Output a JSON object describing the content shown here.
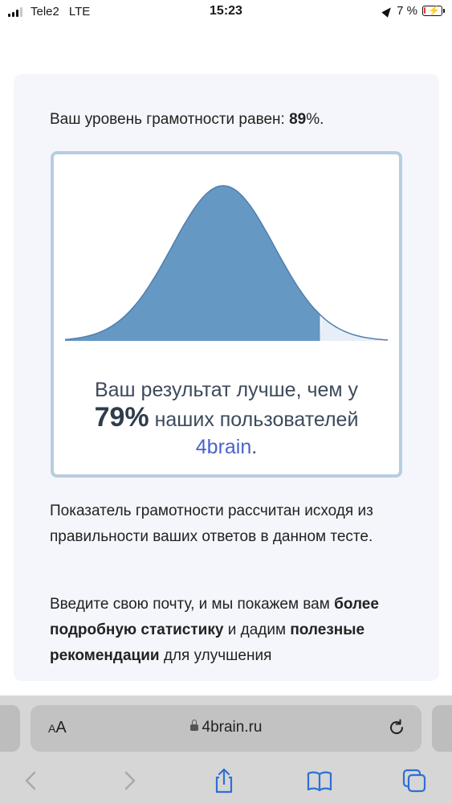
{
  "status_bar": {
    "carrier": "Tele2",
    "network": "LTE",
    "time": "15:23",
    "battery_percent": "7 %",
    "battery_level": 0.07
  },
  "card": {
    "level_prefix": "Ваш уровень грамотности равен: ",
    "level_value": "89",
    "level_suffix": "%.",
    "result": {
      "line1": "Ваш результат лучше, чем у",
      "percent": "79%",
      "line2_rest": " наших пользователей",
      "brand": "4brain",
      "brand_suffix": "."
    },
    "chart_data": {
      "type": "area",
      "description_free": true,
      "distribution": "normal",
      "filled_fraction": 0.79,
      "colors": {
        "filled": "#6598c3",
        "unfilled": "#e8eef7",
        "stroke": "#4f7fae"
      }
    },
    "paragraph1": "Показатель грамотности рассчитан исходя из правильности ваших ответов в данном тесте.",
    "paragraph2_part1": "Введите свою почту, и мы покажем вам ",
    "paragraph2_bold1": "более подробную статистику",
    "paragraph2_part2": " и дадим ",
    "paragraph2_bold2": "полезные рекомендации",
    "paragraph2_part3": " для улучшения"
  },
  "safari": {
    "aa_label_small": "A",
    "aa_label_big": "A",
    "url": "4brain.ru"
  },
  "icons": [
    "location-arrow-icon",
    "battery-icon",
    "lock-icon",
    "reload-icon",
    "back-icon",
    "forward-icon",
    "share-icon",
    "bookmarks-icon",
    "tabs-icon"
  ]
}
